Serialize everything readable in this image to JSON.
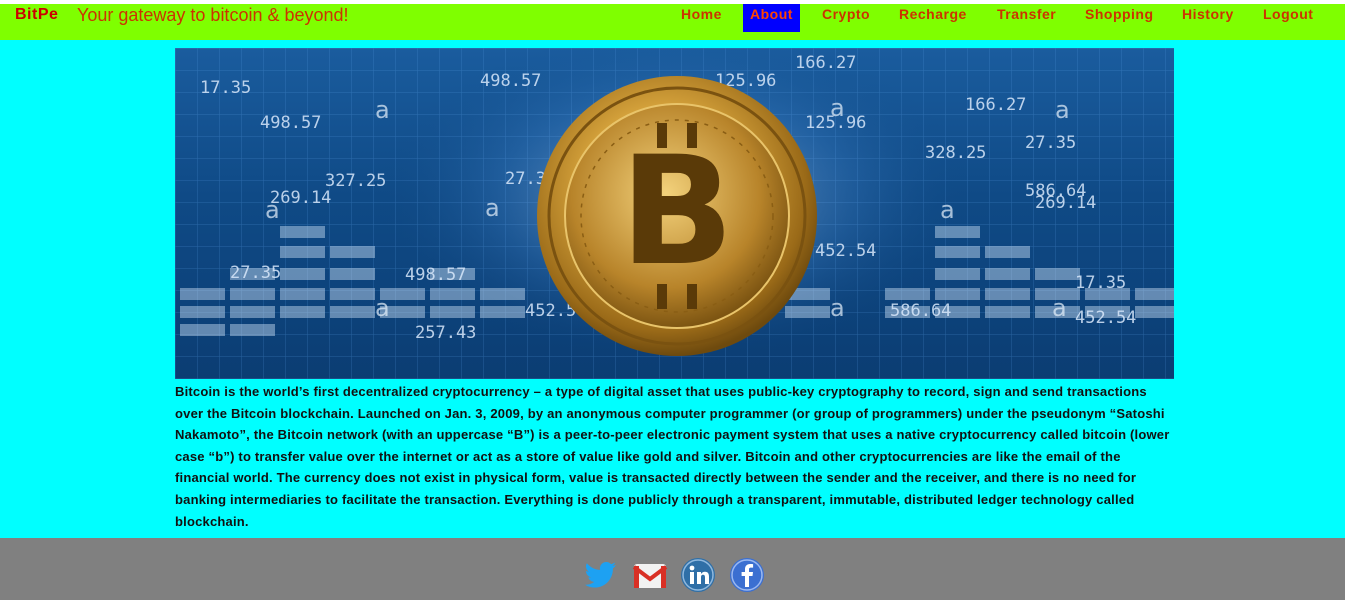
{
  "brand": {
    "name": "BitPe",
    "tagline": "Your gateway to bitcoin & beyond!"
  },
  "nav": {
    "items": [
      {
        "label": "Home"
      },
      {
        "label": "About",
        "active": true
      },
      {
        "label": "Crypto"
      },
      {
        "label": "Recharge"
      },
      {
        "label": "Transfer"
      },
      {
        "label": "Shopping"
      },
      {
        "label": "History"
      },
      {
        "label": "Logout"
      }
    ]
  },
  "hero": {
    "numbers": [
      "17.35",
      "498.57",
      "125.96",
      "166.27",
      "327.25",
      "27.35",
      "269.14",
      "586.64",
      "452.54",
      "257.43",
      "498.57",
      "125.96",
      "166.27",
      "328.25",
      "27.35",
      "586.64",
      "452.54",
      "17.35",
      "498.57",
      "269.14",
      "27.35",
      "586.64",
      "452.54"
    ],
    "watermark": "a",
    "coin_symbol": "B"
  },
  "article": {
    "text": "Bitcoin is the world’s first decentralized cryptocurrency – a type of digital asset that uses public-key cryptography to record, sign and send transactions over the Bitcoin blockchain. Launched on Jan. 3, 2009, by an anonymous computer programmer (or group of programmers) under the pseudonym “Satoshi Nakamoto”, the Bitcoin network (with an uppercase “B”) is a peer-to-peer electronic payment system that uses a native cryptocurrency called bitcoin (lower case “b”) to transfer value over the internet or act as a store of value like gold and silver. Bitcoin and other cryptocurrencies are like the email of the financial world. The currency does not exist in physical form, value is transacted directly between the sender and the receiver, and there is no need for banking intermediaries to facilitate the transaction. Everything is done publicly through a transparent, immutable, distributed ledger technology called blockchain."
  },
  "footer": {
    "social": [
      {
        "icon": "twitter-icon"
      },
      {
        "icon": "gmail-icon"
      },
      {
        "icon": "linkedin-icon"
      },
      {
        "icon": "facebook-icon"
      }
    ]
  },
  "colors": {
    "topbar": "#7fff00",
    "main": "#00ffff",
    "footer": "#808080",
    "brand": "#cc0000",
    "nav_text": "#cc3300",
    "nav_active_bg": "#0000ff"
  }
}
